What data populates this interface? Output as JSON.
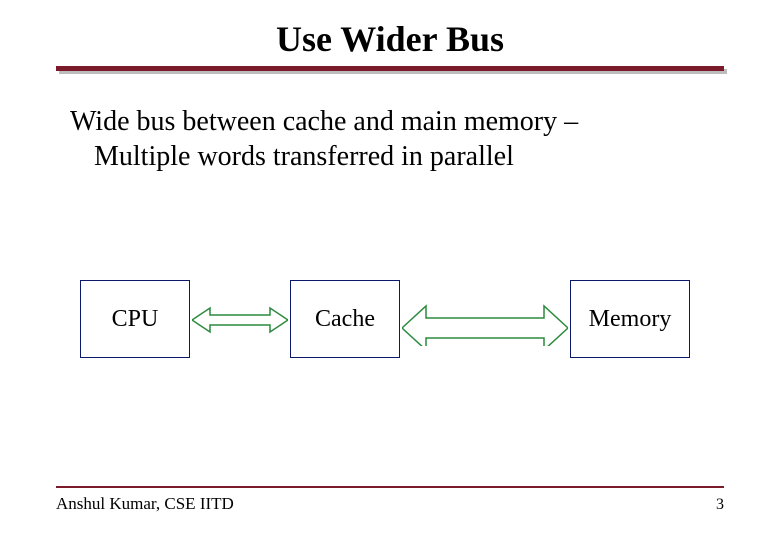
{
  "title": "Use Wider Bus",
  "body": {
    "line1": "Wide bus between cache and main memory –",
    "line2": "Multiple words transferred in parallel"
  },
  "diagram": {
    "cpu_label": "CPU",
    "cache_label": "Cache",
    "memory_label": "Memory"
  },
  "footer": {
    "author": "Anshul Kumar, CSE IITD",
    "page": "3"
  },
  "colors": {
    "accent": "#7a1a2b",
    "box_border": "#0b1a6b",
    "arrow_stroke": "#2b8a3e"
  }
}
